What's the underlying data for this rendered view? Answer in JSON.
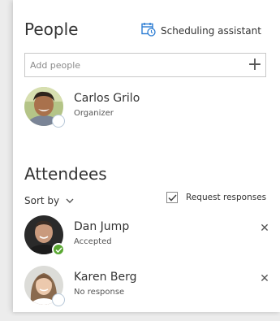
{
  "people": {
    "title": "People",
    "scheduling_label": "Scheduling assistant",
    "add_placeholder": "Add people",
    "organizer": {
      "name": "Carlos Grilo",
      "role": "Organizer"
    }
  },
  "attendees": {
    "title": "Attendees",
    "sort_label": "Sort by",
    "request_responses_label": "Request responses",
    "request_responses_checked": true,
    "list": [
      {
        "name": "Dan Jump",
        "status": "Accepted"
      },
      {
        "name": "Karen Berg",
        "status": "No response"
      }
    ]
  },
  "icons": {
    "scheduling": "calendar-clock-icon",
    "add": "plus-icon",
    "sort": "chevron-down-icon",
    "remove": "close-icon",
    "accepted": "check-icon"
  },
  "colors": {
    "accent": "#2b7cd3",
    "accepted": "#5aa832"
  }
}
